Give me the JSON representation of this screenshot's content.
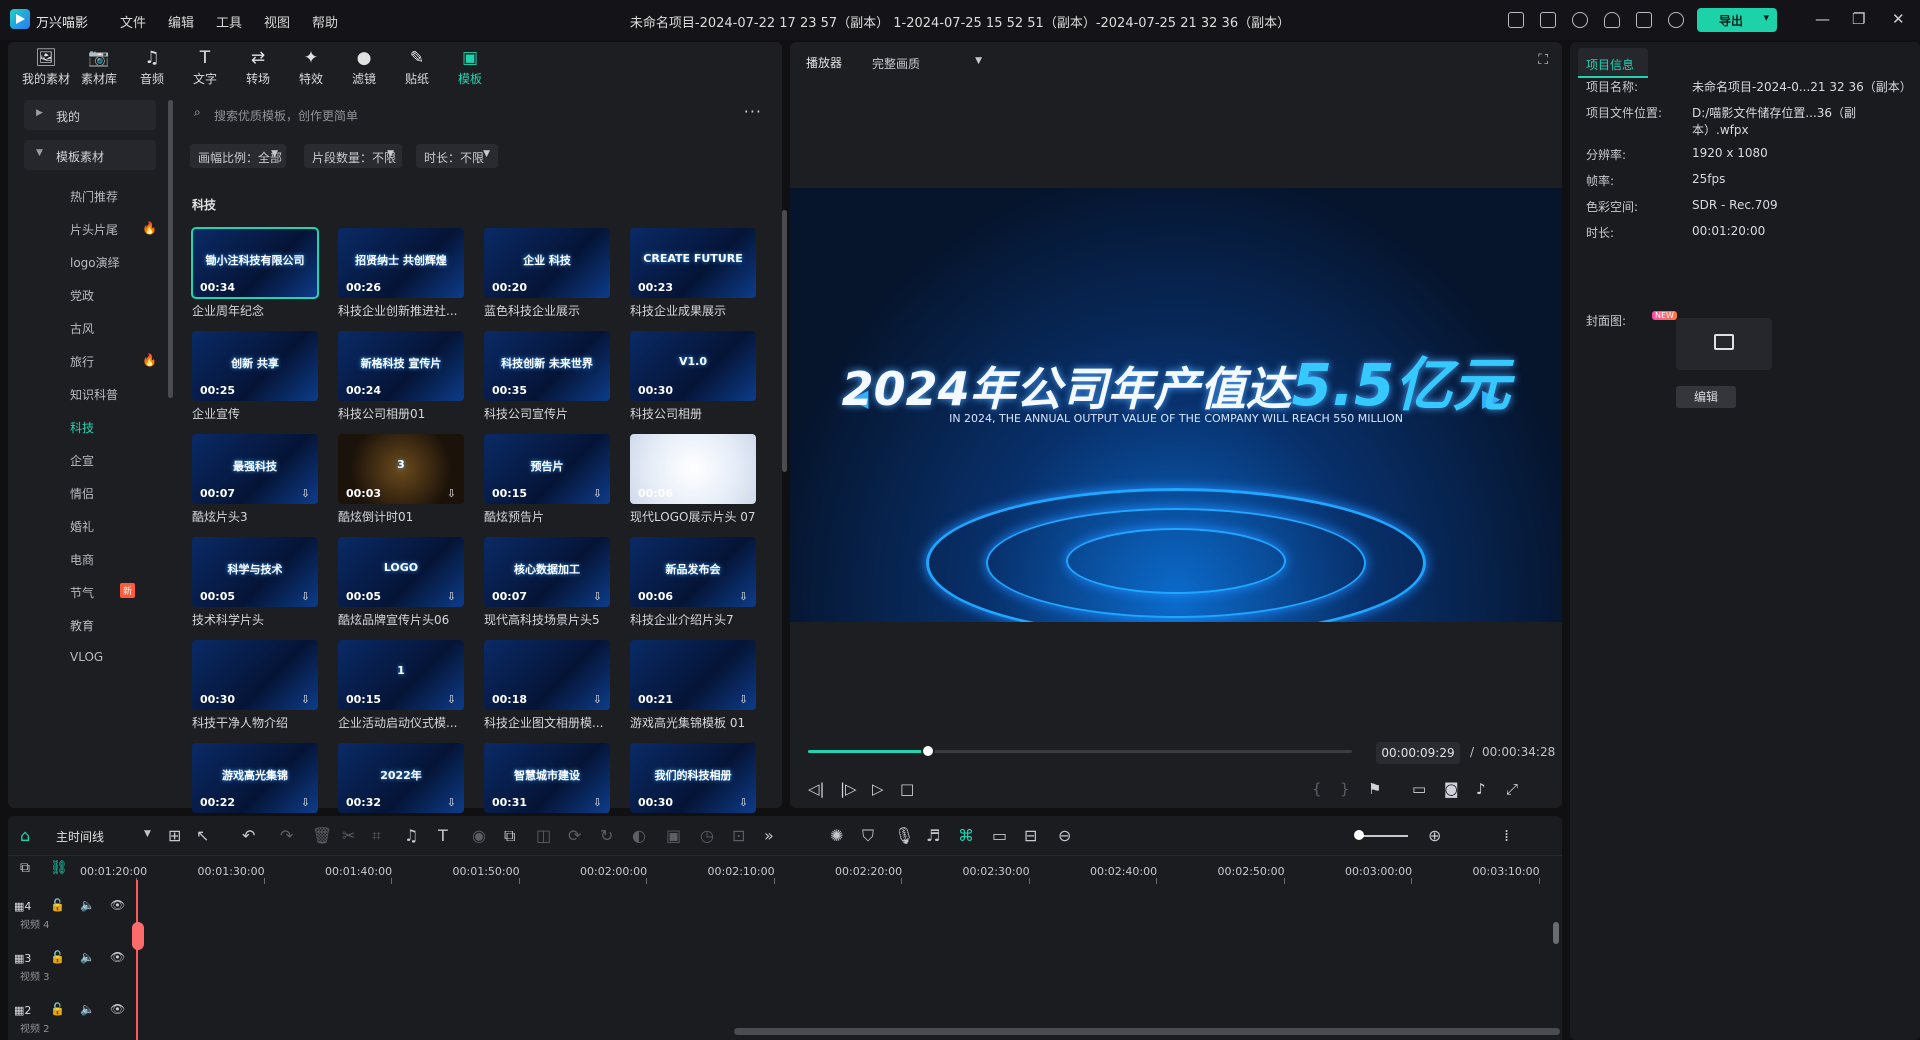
{
  "app": {
    "name": "万兴喵影",
    "title": "未命名项目-2024-07-22 17 23 57（副本） 1-2024-07-25 15 52 51（副本）-2024-07-25 21 32 36（副本）",
    "export_label": "导出"
  },
  "menu": [
    "文件",
    "编辑",
    "工具",
    "视图",
    "帮助"
  ],
  "tool_tabs": [
    {
      "label": "我的素材",
      "icon": "my-media-icon",
      "glyph": "🖼"
    },
    {
      "label": "素材库",
      "icon": "stock-library-icon",
      "glyph": "📷"
    },
    {
      "label": "音频",
      "icon": "music-note-icon",
      "glyph": "♫"
    },
    {
      "label": "文字",
      "icon": "text-icon",
      "glyph": "T"
    },
    {
      "label": "转场",
      "icon": "transition-icon",
      "glyph": "⇄"
    },
    {
      "label": "特效",
      "icon": "effects-sparkle-icon",
      "glyph": "✦"
    },
    {
      "label": "滤镜",
      "icon": "filter-icon",
      "glyph": "●"
    },
    {
      "label": "贴纸",
      "icon": "sticker-icon",
      "glyph": "✎"
    },
    {
      "label": "模板",
      "icon": "template-icon",
      "glyph": "▣",
      "active": true
    }
  ],
  "sidebar": {
    "cat_mine": "我的",
    "cat_templates": "模板素材",
    "items": [
      {
        "label": "热门推荐"
      },
      {
        "label": "片头片尾",
        "flame": true
      },
      {
        "label": "logo演绎"
      },
      {
        "label": "党政"
      },
      {
        "label": "古风"
      },
      {
        "label": "旅行",
        "flame": true
      },
      {
        "label": "知识科普"
      },
      {
        "label": "科技",
        "active": true
      },
      {
        "label": "企宣"
      },
      {
        "label": "情侣"
      },
      {
        "label": "婚礼"
      },
      {
        "label": "电商"
      },
      {
        "label": "节气",
        "badge": "新"
      },
      {
        "label": "教育"
      },
      {
        "label": "VLOG"
      }
    ]
  },
  "search": {
    "placeholder": "搜索优质模板，创作更简单"
  },
  "filters": [
    {
      "label": "画幅比例：全部"
    },
    {
      "label": "片段数量：不限"
    },
    {
      "label": "时长：不限"
    }
  ],
  "section_title": "科技",
  "templates": [
    {
      "title": "企业周年纪念",
      "duration": "00:34",
      "thumb_text": "锄小注科技有限公司",
      "selected": true
    },
    {
      "title": "科技企业创新推进社...",
      "duration": "00:26",
      "thumb_text": "招贤纳士 共创辉煌"
    },
    {
      "title": "蓝色科技企业展示",
      "duration": "00:20",
      "thumb_text": "企业 科技"
    },
    {
      "title": "科技企业成果展示",
      "duration": "00:23",
      "thumb_text": "CREATE FUTURE"
    },
    {
      "title": "企业宣传",
      "duration": "00:25",
      "thumb_text": "创新 共享"
    },
    {
      "title": "科技公司相册01",
      "duration": "00:24",
      "thumb_text": "新格科技 宣传片"
    },
    {
      "title": "科技公司宣传片",
      "duration": "00:35",
      "thumb_text": "科技创新 未来世界"
    },
    {
      "title": "科技公司相册",
      "duration": "00:30",
      "thumb_text": "V1.0"
    },
    {
      "title": "酷炫片头3",
      "duration": "00:07",
      "thumb_text": "最强科技",
      "download": true
    },
    {
      "title": "酷炫倒计时01",
      "duration": "00:03",
      "thumb_text": "3",
      "download": true
    },
    {
      "title": "酷炫预告片",
      "duration": "00:15",
      "thumb_text": "预告片",
      "download": true
    },
    {
      "title": "现代LOGO展示片头 07",
      "duration": "00:06",
      "thumb_text": "",
      "download": true,
      "light": true
    },
    {
      "title": "技术科学片头",
      "duration": "00:05",
      "thumb_text": "科学与技术",
      "download": true
    },
    {
      "title": "酷炫品牌宣传片头06",
      "duration": "00:05",
      "thumb_text": "LOGO",
      "download": true
    },
    {
      "title": "现代高科技场景片头5",
      "duration": "00:07",
      "thumb_text": "核心数据加工",
      "download": true
    },
    {
      "title": "科技企业介绍片头7",
      "duration": "00:06",
      "thumb_text": "新品发布会",
      "download": true
    },
    {
      "title": "科技干净人物介绍",
      "duration": "00:30",
      "thumb_text": "",
      "download": true
    },
    {
      "title": "企业活动启动仪式模...",
      "duration": "00:15",
      "thumb_text": "1",
      "download": true
    },
    {
      "title": "科技企业图文相册模...",
      "duration": "00:18",
      "thumb_text": "",
      "download": true
    },
    {
      "title": "游戏高光集锦模板 01",
      "duration": "00:21",
      "thumb_text": "",
      "download": true
    },
    {
      "title": "",
      "duration": "00:22",
      "thumb_text": "游戏高光集锦",
      "download": true
    },
    {
      "title": "",
      "duration": "00:32",
      "thumb_text": "2022年",
      "download": true
    },
    {
      "title": "",
      "duration": "00:31",
      "thumb_text": "智慧城市建设",
      "download": true
    },
    {
      "title": "",
      "duration": "00:30",
      "thumb_text": "我们的科技相册",
      "download": true
    }
  ],
  "player": {
    "label": "播放器",
    "quality": "完整画质",
    "headline_main": "2024年公司年产值达",
    "headline_highlight": "5.5亿元",
    "subline": "IN 2024, THE ANNUAL OUTPUT VALUE OF THE COMPANY WILL REACH 550 MILLION",
    "current_time": "00:00:09:29",
    "total_time": "00:00:34:28",
    "progress_fraction": 0.22
  },
  "project_info": {
    "tab_label": "项目信息",
    "rows": [
      {
        "k": "项目名称:",
        "v": "未命名项目-2024-0...21 32 36（副本）"
      },
      {
        "k": "项目文件位置:",
        "v": "D:/喵影文件储存位置...36（副本）.wfpx"
      },
      {
        "k": "分辨率:",
        "v": "1920 x 1080"
      },
      {
        "k": "帧率:",
        "v": "25fps"
      },
      {
        "k": "色彩空间:",
        "v": "SDR - Rec.709"
      },
      {
        "k": "时长:",
        "v": "00:01:20:00"
      }
    ],
    "cover_label": "封面图:",
    "new_tag": "NEW",
    "edit_label": "编辑"
  },
  "timeline": {
    "track_selector": "主时间线",
    "ruler_ticks": [
      "00:01:20:00",
      "00:01:30:00",
      "00:01:40:00",
      "00:01:50:00",
      "00:02:00:00",
      "00:02:10:00",
      "00:02:20:00",
      "00:02:30:00",
      "00:02:40:00",
      "00:02:50:00",
      "00:03:00:00",
      "00:03:10:00"
    ],
    "tracks": [
      {
        "num": "4",
        "name": "视频 4"
      },
      {
        "num": "3",
        "name": "视频 3"
      },
      {
        "num": "2",
        "name": "视频 2"
      }
    ]
  }
}
